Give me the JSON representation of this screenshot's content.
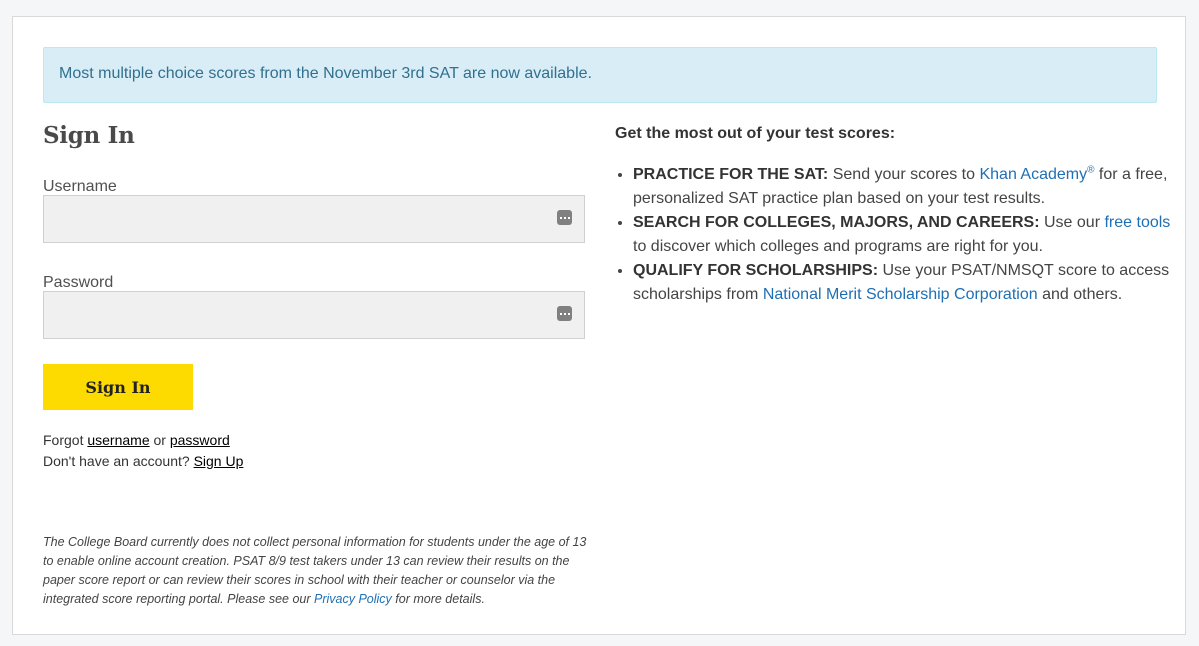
{
  "alert": {
    "text": "Most multiple choice scores from the November 3rd SAT are now available."
  },
  "signin": {
    "title": "Sign In",
    "username_label": "Username",
    "username_value": "",
    "password_label": "Password",
    "password_value": "",
    "button_label": "Sign In",
    "forgot_prefix": "Forgot",
    "forgot_username": "username",
    "forgot_or": "or",
    "forgot_password": "password",
    "no_account": "Don't have an account?",
    "signup_link": "Sign Up"
  },
  "disclaimer": {
    "text": "The College Board currently does not collect personal information for students under the age of 13 to enable online account creation. PSAT 8/9 test takers under 13 can review their results on the paper score report or can review their scores in school with their teacher or counselor via the integrated score reporting portal. Please see our",
    "link": "Privacy Policy",
    "suffix": "for more details."
  },
  "benefits": {
    "title": "Get the most out of your test scores:",
    "items": [
      {
        "heading": "PRACTICE FOR THE SAT:",
        "before": "Send your scores to",
        "link": "Khan Academy",
        "sup": "®",
        "after": "for a free, personalized SAT practice plan based on your test results."
      },
      {
        "heading": "SEARCH FOR COLLEGES, MAJORS, AND CAREERS:",
        "before": "Use our",
        "link": "free tools",
        "after": "to discover which colleges and programs are right for you."
      },
      {
        "heading": "QUALIFY FOR SCHOLARSHIPS:",
        "before": "Use your PSAT/NMSQT score to access scholarships from",
        "link": "National Merit Scholarship Corporation",
        "after": "and others."
      }
    ]
  },
  "colors": {
    "alert_bg": "#d9edf7",
    "alert_text": "#31708f",
    "button_bg": "#fedb00",
    "link": "#1f6fb4"
  },
  "icons": {
    "field_icon": "keyboard-dots-icon"
  }
}
